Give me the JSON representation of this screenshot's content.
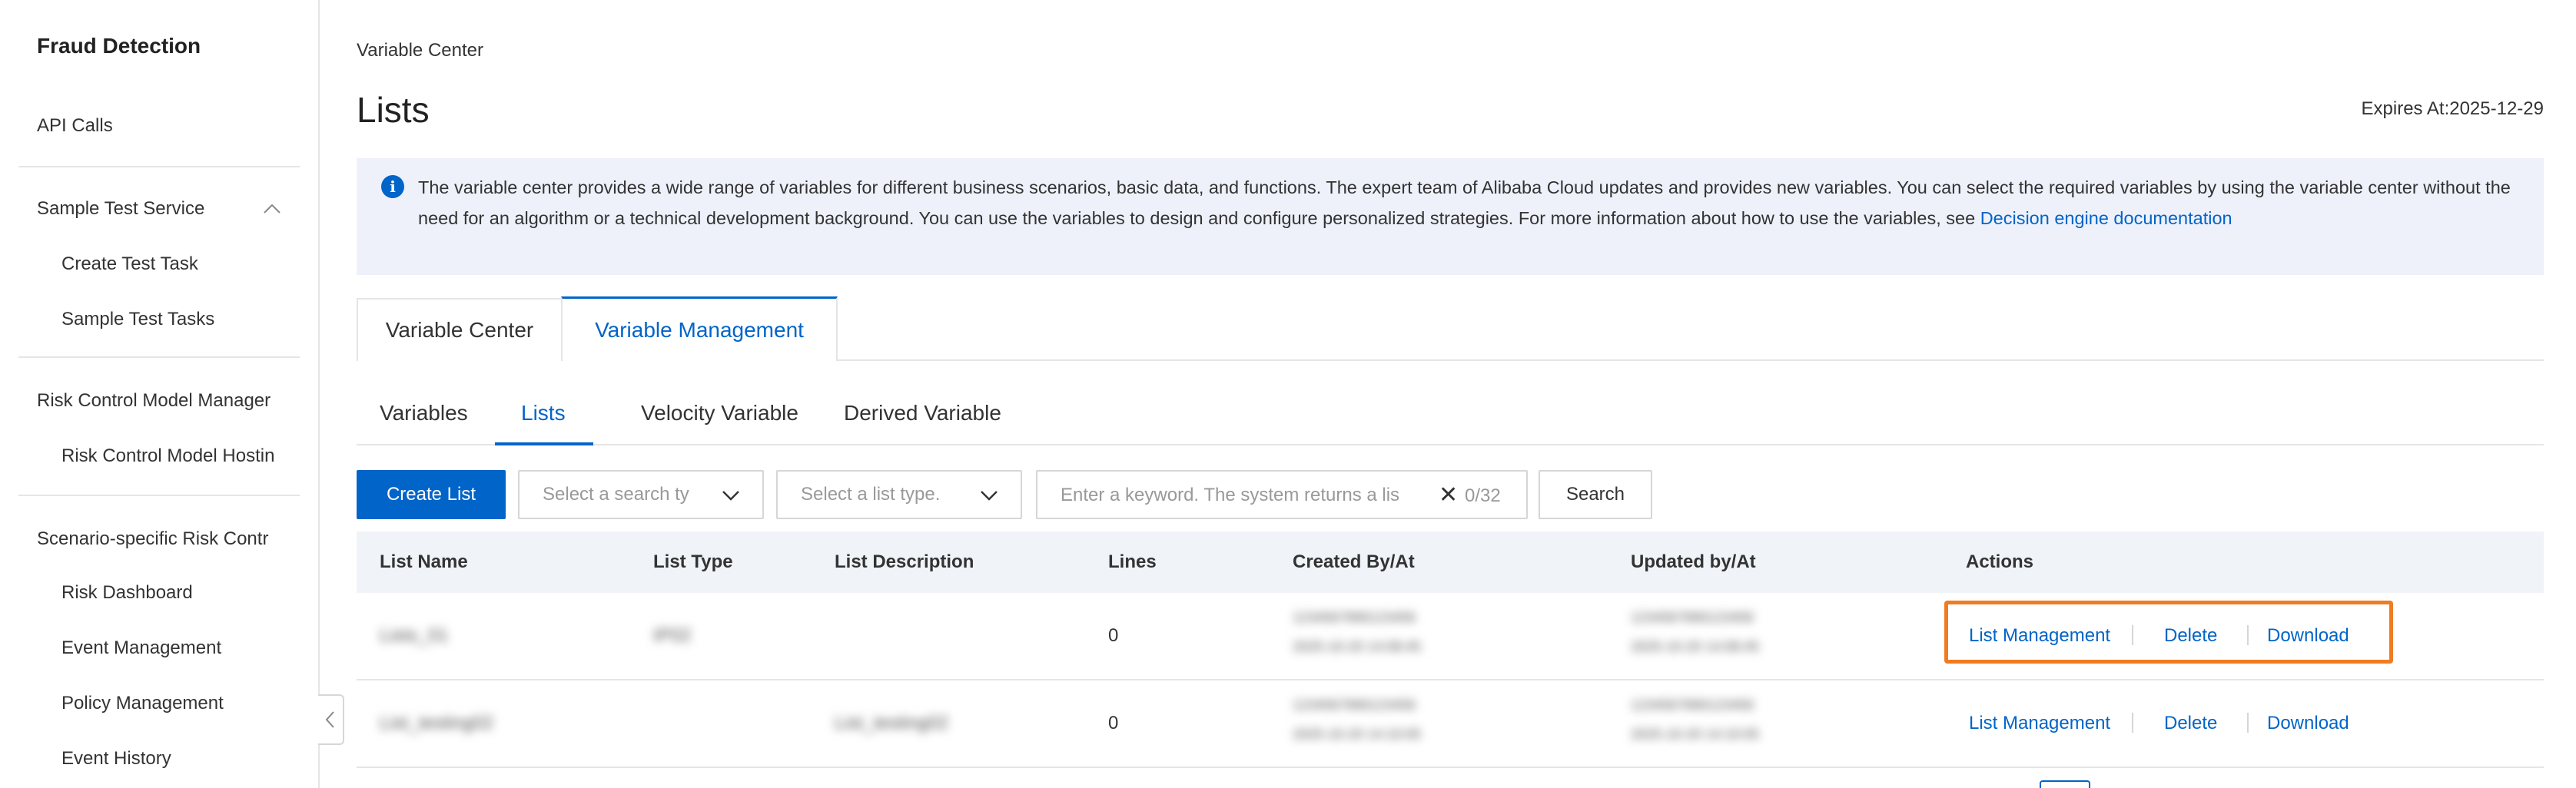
{
  "sidebar": {
    "title": "Fraud Detection",
    "items": [
      {
        "label": "API Calls"
      },
      {
        "label": "Sample Test Service"
      },
      {
        "label": "Create Test Task"
      },
      {
        "label": "Sample Test Tasks"
      },
      {
        "label": "Risk Control Model Manager"
      },
      {
        "label": "Risk Control Model Hostin"
      },
      {
        "label": "Scenario-specific Risk Contr"
      },
      {
        "label": "Risk Dashboard"
      },
      {
        "label": "Event Management"
      },
      {
        "label": "Policy Management"
      },
      {
        "label": "Event History"
      }
    ]
  },
  "header": {
    "breadcrumb": "Variable Center",
    "title": "Lists",
    "expires": "Expires At:2025-12-29"
  },
  "notice": {
    "text": "The variable center provides a wide range of variables for different business scenarios, basic data, and functions. The expert team of Alibaba Cloud updates and provides new variables. You can select the required variables by using the variable center without the need for an algorithm or a technical development background. You can use the variables to design and configure personalized strategies. For more information about how to use the variables, see ",
    "link_label": "Decision engine documentation"
  },
  "top_tabs": [
    {
      "label": "Variable Center",
      "active": false
    },
    {
      "label": "Variable Management",
      "active": true
    }
  ],
  "sub_tabs": [
    {
      "label": "Variables",
      "active": false
    },
    {
      "label": "Lists",
      "active": true
    },
    {
      "label": "Velocity Variable",
      "active": false
    },
    {
      "label": "Derived Variable",
      "active": false
    }
  ],
  "toolbar": {
    "create_label": "Create List",
    "search_type_placeholder": "Select a search ty",
    "list_type_placeholder": "Select a list type.",
    "keyword_placeholder": "Enter a keyword. The system returns a lis",
    "keyword_value": "",
    "keyword_count": "0/32",
    "search_label": "Search"
  },
  "table": {
    "columns": [
      "List Name",
      "List Type",
      "List Description",
      "Lines",
      "Created By/At",
      "Updated by/At",
      "Actions"
    ],
    "rows": [
      {
        "name": "Lists_01",
        "type": "IP02",
        "description": "",
        "lines": "0",
        "created_by": "1234567890123456",
        "created_at": "2025-10-20 14:08:45",
        "updated_by": "1234567890123456",
        "updated_at": "2025-10-20 14:08:45",
        "actions": [
          "List Management",
          "Delete",
          "Download"
        ]
      },
      {
        "name": "List_testing02",
        "type": "",
        "description": "List_testing02",
        "lines": "0",
        "created_by": "1234567890123456",
        "created_at": "2025-10-20 14:10:05",
        "updated_by": "1234567890123456",
        "updated_at": "2025-10-20 14:10:05",
        "actions": [
          "List Management",
          "Delete",
          "Download"
        ]
      }
    ]
  },
  "colors": {
    "brand_blue": "#0064c8",
    "highlight_orange": "#f07c22",
    "notice_bg": "#eef1fa",
    "table_header_bg": "#f0f3f8"
  },
  "icons": [
    "info-icon",
    "chevron-up-icon",
    "chevron-down-icon",
    "clear-icon",
    "collapse-left-icon"
  ]
}
